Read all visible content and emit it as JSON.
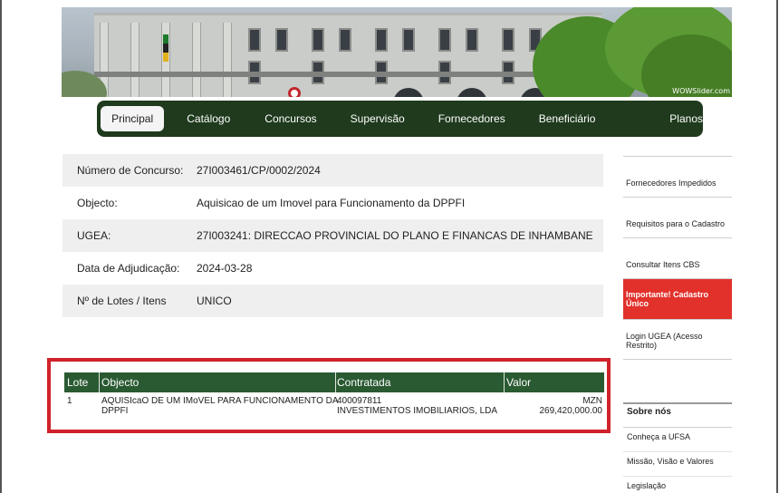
{
  "banner": {
    "watermark": "WOWSlider.com"
  },
  "nav": {
    "items": [
      {
        "label": "Principal"
      },
      {
        "label": "Catálogo"
      },
      {
        "label": "Concursos"
      },
      {
        "label": "Supervisão"
      },
      {
        "label": "Fornecedores"
      },
      {
        "label": "Beneficiário Efectivo"
      },
      {
        "label": "Planos"
      }
    ]
  },
  "tender": {
    "rows": [
      {
        "label": "Número de Concurso:",
        "value": "27I003461/CP/0002/2024"
      },
      {
        "label": "Objecto:",
        "value": "Aquisicao de um Imovel para Funcionamento da DPPFI"
      },
      {
        "label": "UGEA:",
        "value": "27I003241: DIRECCAO PROVINCIAL DO PLANO E FINANCAS DE INHAMBANE"
      },
      {
        "label": "Data de Adjudicação:",
        "value": "2024-03-28"
      },
      {
        "label": "Nº de Lotes / Itens",
        "value": "UNICO"
      }
    ]
  },
  "results": {
    "headers": {
      "lote": "Lote",
      "objecto": "Objecto",
      "contratada": "Contratada",
      "valor": "Valor"
    },
    "row": {
      "lote": "1",
      "objecto_line1": "AQUISIcaO DE UM IMoVEL PARA FUNCIONAMENTO DA",
      "objecto_line2": "DPPFI",
      "contratada_line1": "400097811",
      "contratada_line2": "INVESTIMENTOS IMOBILIARIOS, LDA",
      "currency": "MZN",
      "amount": "269,420,000.00"
    }
  },
  "sidebar": {
    "items": [
      {
        "label": "Fornecedores Impedidos"
      },
      {
        "label": "Requisitos para o Cadastro"
      },
      {
        "label": "Consultar Itens CBS"
      },
      {
        "label": "Importante! Cadastro Único"
      },
      {
        "label": "Login UGEA (Acesso Restrito)"
      }
    ],
    "about_heading": "Sobre nós",
    "about_links": [
      {
        "label": "Conheça a UFSA"
      },
      {
        "label": "Missão, Visão e Valores"
      },
      {
        "label": "Legislação"
      }
    ]
  },
  "colors": {
    "nav_bg": "#1f3a1d",
    "table_header": "#2a5a32",
    "highlight_border": "#d0222a",
    "important_bg": "#e2312b"
  }
}
